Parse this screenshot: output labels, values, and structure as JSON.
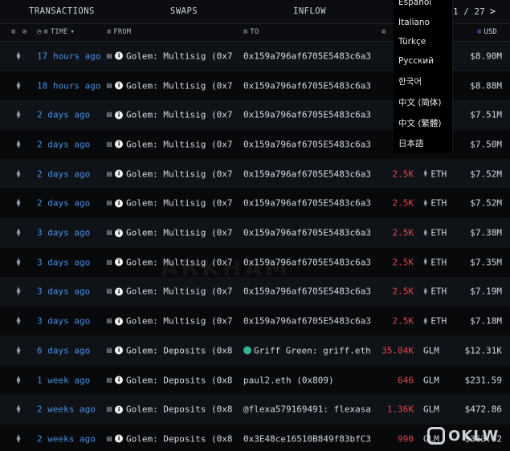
{
  "tabs": {
    "transactions": "TRANSACTIONS",
    "swaps": "SWAPS",
    "inflow": "INFLOW"
  },
  "pager": {
    "text": "1 / 27",
    "next": ">"
  },
  "headers": {
    "time": "TIME",
    "from": "FROM",
    "to": "TO",
    "usd": "USD"
  },
  "language_menu": [
    "Español",
    "Italiano",
    "Türkçe",
    "Русский",
    "한국어",
    "中文 (简体)",
    "中文 (繁體)",
    "日本語"
  ],
  "watermark": "ARKHAM",
  "badge": "OKLW",
  "rows": [
    {
      "time": "17 hours ago",
      "from": "Golem: Multisig (0x7",
      "to": "0x159a796af6705E5483c6a3",
      "amount": "",
      "token": "",
      "usd": "$8.90M",
      "to_icon": false
    },
    {
      "time": "18 hours ago",
      "from": "Golem: Multisig (0x7",
      "to": "0x159a796af6705E5483c6a3",
      "amount": "",
      "token": "",
      "usd": "$8.88M",
      "to_icon": false
    },
    {
      "time": "2 days ago",
      "from": "Golem: Multisig (0x7",
      "to": "0x159a796af6705E5483c6a3",
      "amount": "",
      "token": "",
      "usd": "$7.51M",
      "to_icon": false
    },
    {
      "time": "2 days ago",
      "from": "Golem: Multisig (0x7",
      "to": "0x159a796af6705E5483c6a3",
      "amount": "",
      "token": "",
      "usd": "$7.50M",
      "to_icon": false
    },
    {
      "time": "2 days ago",
      "from": "Golem: Multisig (0x7",
      "to": "0x159a796af6705E5483c6a3",
      "amount": "2.5K",
      "token": "ETH",
      "usd": "$7.52M",
      "to_icon": false
    },
    {
      "time": "2 days ago",
      "from": "Golem: Multisig (0x7",
      "to": "0x159a796af6705E5483c6a3",
      "amount": "2.5K",
      "token": "ETH",
      "usd": "$7.52M",
      "to_icon": false
    },
    {
      "time": "3 days ago",
      "from": "Golem: Multisig (0x7",
      "to": "0x159a796af6705E5483c6a3",
      "amount": "2.5K",
      "token": "ETH",
      "usd": "$7.38M",
      "to_icon": false
    },
    {
      "time": "3 days ago",
      "from": "Golem: Multisig (0x7",
      "to": "0x159a796af6705E5483c6a3",
      "amount": "2.5K",
      "token": "ETH",
      "usd": "$7.35M",
      "to_icon": false
    },
    {
      "time": "3 days ago",
      "from": "Golem: Multisig (0x7",
      "to": "0x159a796af6705E5483c6a3",
      "amount": "2.5K",
      "token": "ETH",
      "usd": "$7.19M",
      "to_icon": false
    },
    {
      "time": "3 days ago",
      "from": "Golem: Multisig (0x7",
      "to": "0x159a796af6705E5483c6a3",
      "amount": "2.5K",
      "token": "ETH",
      "usd": "$7.18M",
      "to_icon": false
    },
    {
      "time": "6 days ago",
      "from": "Golem: Deposits (0x8",
      "to": "Griff Green: griff.eth",
      "amount": "35.04K",
      "token": "GLM",
      "usd": "$12.31K",
      "to_icon": true
    },
    {
      "time": "1 week ago",
      "from": "Golem: Deposits (0x8",
      "to": "paul2.eth (0x809)",
      "amount": "646",
      "token": "GLM",
      "usd": "$231.59",
      "to_icon": false
    },
    {
      "time": "2 weeks ago",
      "from": "Golem: Deposits (0x8",
      "to": "@flexa579169491: flexasa",
      "amount": "1.36K",
      "token": "GLM",
      "usd": "$472.86",
      "to_icon": false
    },
    {
      "time": "2 weeks ago",
      "from": "Golem: Deposits (0x8",
      "to": "0x3E48ce16510B849f83bfC3",
      "amount": "990",
      "token": "GLM",
      "usd": "$363.02",
      "to_icon": false
    }
  ]
}
